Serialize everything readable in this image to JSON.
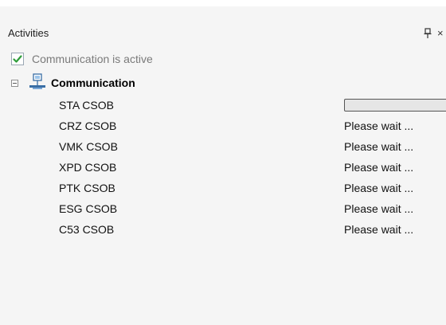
{
  "panel": {
    "title": "Activities",
    "close_glyph": "×",
    "pin_icon": "pin-icon"
  },
  "status_checkbox": {
    "checked": true,
    "label": "Communication is active"
  },
  "tree": {
    "group_label": "Communication",
    "group_icon": "network-computer-icon",
    "expanded": true,
    "items": [
      {
        "name": "STA CSOB",
        "status": "",
        "progress": 0
      },
      {
        "name": "CRZ CSOB",
        "status": "Please wait ..."
      },
      {
        "name": "VMK CSOB",
        "status": "Please wait ..."
      },
      {
        "name": "XPD CSOB",
        "status": "Please wait ..."
      },
      {
        "name": "PTK CSOB",
        "status": "Please wait ..."
      },
      {
        "name": "ESG CSOB",
        "status": "Please wait ..."
      },
      {
        "name": "C53 CSOB",
        "status": "Please wait ..."
      }
    ]
  },
  "colors": {
    "panel_bg": "#f5f5f5",
    "check_green": "#2e9d3a",
    "progress_fill": "#06b025"
  }
}
